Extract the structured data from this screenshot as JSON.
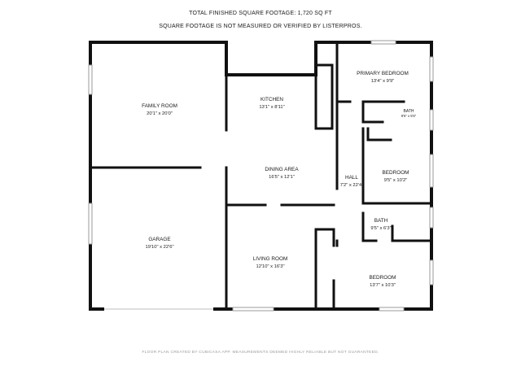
{
  "header": {
    "total_sqft": "TOTAL FINISHED SQUARE FOOTAGE: 1,720 SQ FT",
    "note": "SQUARE FOOTAGE IS NOT MEASURED OR VERIFIED BY LISTERPROS."
  },
  "rooms": {
    "family_room": {
      "name": "FAMILY ROOM",
      "dim": "20'1\" x 20'0\""
    },
    "kitchen": {
      "name": "KITCHEN",
      "dim": "13'1\" x 8'11\""
    },
    "primary_bedroom": {
      "name": "PRIMARY BEDROOM",
      "dim": "13'4\" x 9'9\""
    },
    "primary_bath": {
      "name": "BATH",
      "dim": "9'5\" x 5'5\""
    },
    "dining_area": {
      "name": "DINING AREA",
      "dim": "16'5\" x 12'1\""
    },
    "hall": {
      "name": "HALL",
      "dim": "7'2\" x 22'4\""
    },
    "bedroom_2": {
      "name": "BEDROOM",
      "dim": "9'5\" x 10'2\""
    },
    "bath_2": {
      "name": "BATH",
      "dim": "9'5\" x 6'3\""
    },
    "garage": {
      "name": "GARAGE",
      "dim": "19'10\" x 22'6\""
    },
    "living_room": {
      "name": "LIVING ROOM",
      "dim": "12'10\" x 16'3\""
    },
    "bedroom_3": {
      "name": "BEDROOM",
      "dim": "13'7\" x 10'3\""
    }
  },
  "footer": "FLOOR PLAN CREATED BY CUBICASA APP. MEASUREMENTS DEEMED HIGHLY RELIABLE BUT NOT GUARANTEED."
}
